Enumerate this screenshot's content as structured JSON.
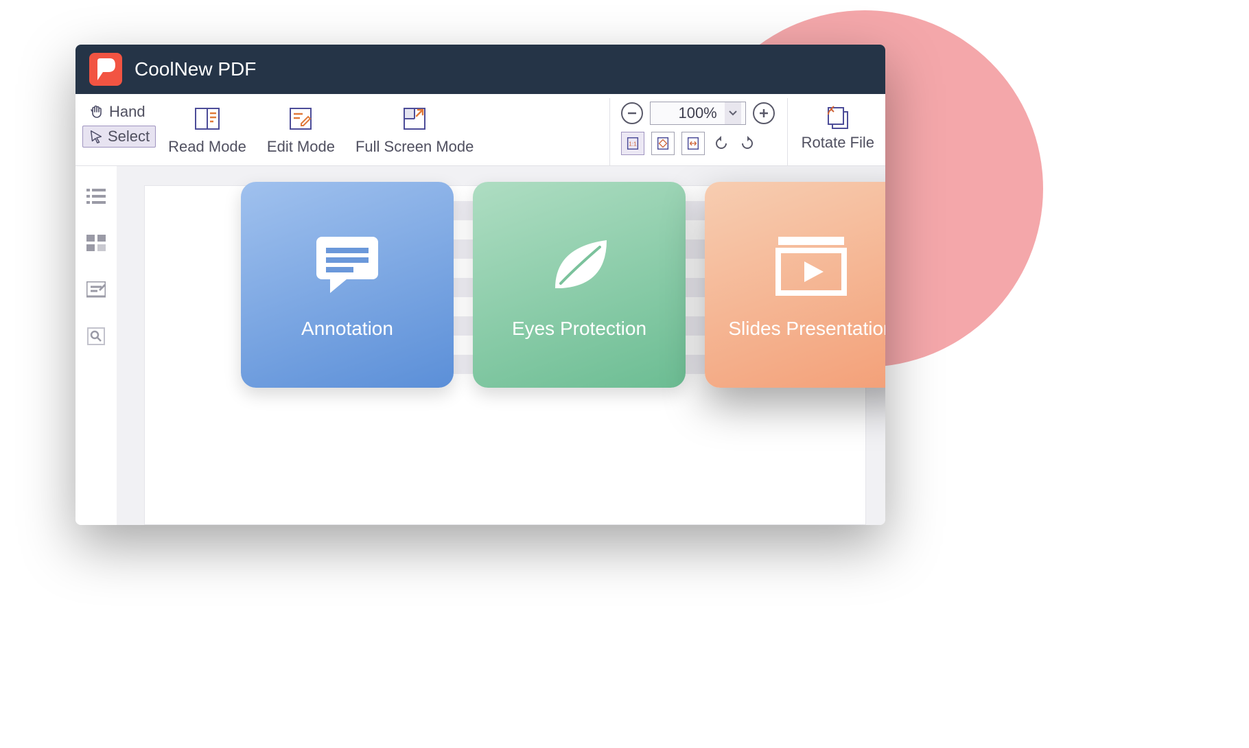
{
  "app": {
    "title": "CoolNew PDF"
  },
  "toolbar": {
    "cursor": {
      "hand": "Hand",
      "select": "Select"
    },
    "modes": {
      "read": "Read Mode",
      "edit": "Edit Mode",
      "full": "Full Screen Mode"
    },
    "zoom": {
      "level": "100%"
    },
    "rotate": "Rotate File"
  },
  "sidebar_icons": [
    "outline",
    "thumbnails",
    "comments",
    "search"
  ],
  "cards": {
    "annotation": "Annotation",
    "eyes": "Eyes Protection",
    "slides": "Slides Presentation"
  },
  "colors": {
    "titlebar": "#253447",
    "logo": "#f25442",
    "accent": "#5b8fd8",
    "green": "#6cbd93",
    "orange": "#f39f77",
    "bgcircle": "#f4a7aa"
  }
}
